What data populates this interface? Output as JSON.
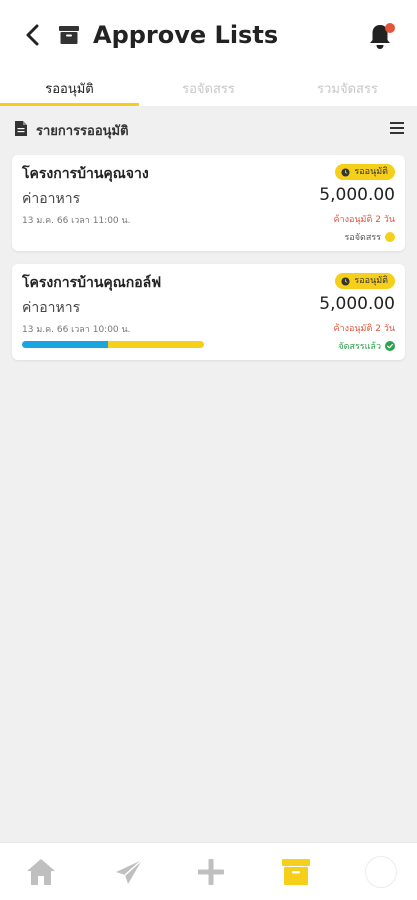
{
  "header": {
    "title": "Approve Lists"
  },
  "tabs": [
    {
      "label": "รออนุมัติ",
      "active": true
    },
    {
      "label": "รอจัดสรร",
      "active": false
    },
    {
      "label": "รวมจัดสรร",
      "active": false
    }
  ],
  "section": {
    "title": "รายการรออนุมัติ"
  },
  "cards": [
    {
      "title": "โครงการบ้านคุณจาง",
      "category": "ค่าอาหาร",
      "date": "13 ม.ค. 66 เวลา 11:00 น.",
      "badge": "รออนุมัติ",
      "amount": "5,000.00",
      "due": "ค้างอนุมัติ 2 วัน",
      "status": "รอจัดสรร",
      "status_color": "#f5cf1a"
    },
    {
      "title": "โครงการบ้านคุณกอล์ฟ",
      "category": "ค่าอาหาร",
      "date": "13 ม.ค. 66 เวลา 10:00 น.",
      "badge": "รออนุมัติ",
      "amount": "5,000.00",
      "due": "ค้างอนุมัติ 2 วัน",
      "status": "จัดสรรแล้ว",
      "status_color": "#2aa14a",
      "progress": 0.47
    }
  ],
  "bottom_nav": [
    {
      "icon": "home-icon"
    },
    {
      "icon": "send-icon"
    },
    {
      "icon": "plus-icon"
    },
    {
      "icon": "archive-icon",
      "active": true
    },
    {
      "icon": "brand-logo"
    }
  ],
  "colors": {
    "accent": "#f5cf1a",
    "alert": "#e5533a",
    "success": "#2aa14a",
    "progress_blue": "#1aa4e0"
  }
}
